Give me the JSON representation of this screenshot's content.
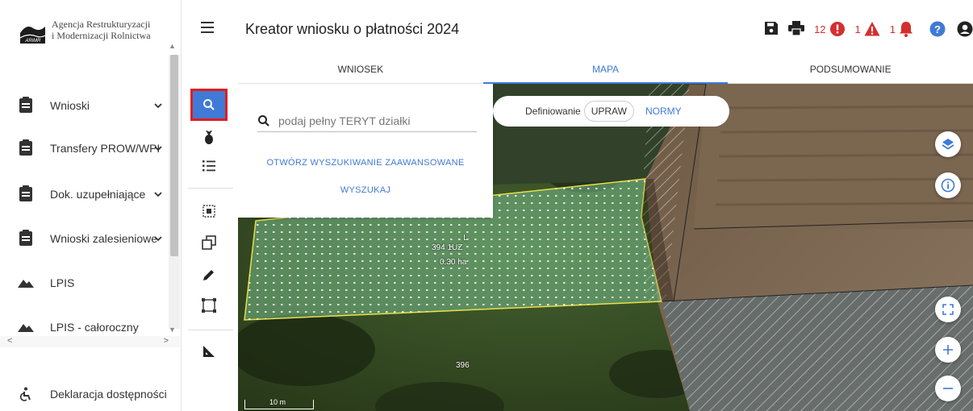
{
  "sidebar": {
    "logo_line1": "Agencja Restrukturyzacji",
    "logo_line2": "i Modernizacji Rolnictwa",
    "logo_mark_text": "ARiMR",
    "items": [
      {
        "label": "Wnioski",
        "icon": "clipboard-icon",
        "expandable": true
      },
      {
        "label": "Transfery PROW/WPR",
        "icon": "clipboard-icon",
        "expandable": true
      },
      {
        "label": "Dok. uzupełniające",
        "icon": "clipboard-icon",
        "expandable": true
      },
      {
        "label": "Wnioski zalesieniowe",
        "icon": "clipboard-icon",
        "expandable": true
      },
      {
        "label": "LPIS",
        "icon": "mountain-icon",
        "expandable": false
      },
      {
        "label": "LPIS - całoroczny",
        "icon": "mountain-icon",
        "expandable": false
      }
    ],
    "footer_item": {
      "label": "Deklaracja dostępności",
      "icon": "accessibility-icon"
    }
  },
  "header": {
    "title": "Kreator wniosku o płatności 2024",
    "errors_count": "12",
    "warnings_count": "1",
    "notifications_count": "1"
  },
  "tabs": [
    {
      "label": "WNIOSEK",
      "active": false
    },
    {
      "label": "MAPA",
      "active": true
    },
    {
      "label": "PODSUMOWANIE",
      "active": false
    }
  ],
  "search": {
    "placeholder": "podaj pełny TERYT działki",
    "advanced_label": "OTWÓRZ WYSZUKIWANIE ZAAWANSOWANE",
    "search_label": "WYSZUKAJ"
  },
  "definition": {
    "label": "Definiowanie",
    "options": [
      "UPRAW",
      "NORMY"
    ],
    "selected": "UPRAW"
  },
  "map": {
    "parcel_label_line1": "L",
    "parcel_label_line2": "394 1UZ",
    "parcel_label_line3": "0.30 ha",
    "plot_number": "396",
    "scale_label": "10 m"
  },
  "colors": {
    "accent": "#3f7ad6",
    "error": "#d32f2f",
    "highlight": "#e01e1e"
  }
}
